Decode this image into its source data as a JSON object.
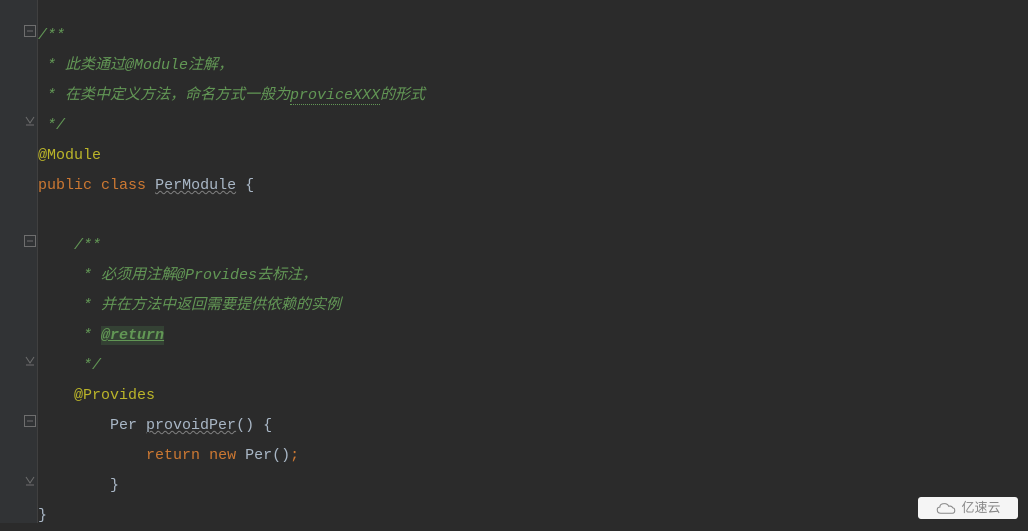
{
  "code": {
    "c1": "/**",
    "c2": " * 此类通过@Module注解，",
    "c3_pre": " * 在类中定义方法，命名方式一般为",
    "c3_link": "proviceXXX",
    "c3_post": "的形式",
    "c4": " */",
    "anno1": "@Module",
    "kw_public": "public",
    "kw_class": "class",
    "classname": "PerModule",
    "brace_open": " {",
    "c5": "/**",
    "c6": " * 必须用注解@Provides去标注，",
    "c7": " * 并在方法中返回需要提供依赖的实例",
    "c8_pre": " * ",
    "c8_tag": "@return",
    "c9": " */",
    "anno2": "@Provides",
    "type_per": "Per",
    "method": "provoidPer",
    "parens": "()",
    "brace_open2": " {",
    "kw_return": "return",
    "kw_new": "new",
    "ctor": "Per",
    "parens2": "()",
    "semi": ";",
    "brace_close": "}",
    "brace_close2": "}"
  },
  "watermark": {
    "text": "亿速云"
  },
  "indent": {
    "i0": "",
    "i1": "    ",
    "i2": "        ",
    "i3": "            "
  }
}
